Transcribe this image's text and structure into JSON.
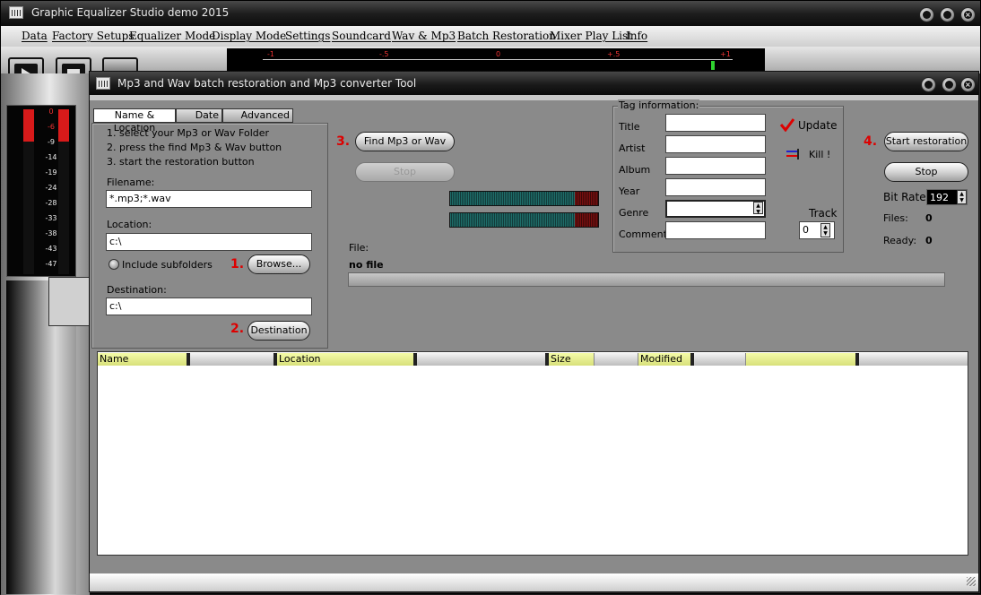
{
  "window": {
    "title": "Graphic Equalizer Studio demo 2015"
  },
  "menu": [
    "Data",
    "Factory Setups",
    "Equalizer Mode",
    "Display Mode",
    "Settings",
    "Soundcard",
    "Wav & Mp3",
    "Batch Restoration",
    "Mixer Play List",
    "Info"
  ],
  "ruler": {
    "labels": [
      "-1",
      "-.5",
      "0",
      "+.5",
      "+1"
    ]
  },
  "meter": {
    "labels": [
      "0",
      "-6",
      "-9",
      "-14",
      "-19",
      "-24",
      "-28",
      "-33",
      "-38",
      "-43",
      "-47"
    ]
  },
  "tool": {
    "title": "Mp3 and Wav batch restoration and Mp3 converter Tool",
    "tabs": [
      "Name & Location",
      "Date",
      "Advanced"
    ],
    "instructions": [
      "1. select your Mp3 or Wav Folder",
      "2. press the find Mp3 & Wav button",
      "3. start the restoration button"
    ],
    "filename_label": "Filename:",
    "filename_value": "*.mp3;*.wav",
    "location_label": "Location:",
    "location_value": "c:\\",
    "include_subfolders": "Include subfolders",
    "browse": "Browse...",
    "destination_label": "Destination:",
    "destination_value": "c:\\",
    "destination_button": "Destination",
    "step1": "1.",
    "step2": "2.",
    "step3": "3.",
    "step4": "4.",
    "find": "Find Mp3 or Wav",
    "stop_disabled": "Stop",
    "file_label": "File:",
    "file_value": "no file",
    "tag": {
      "group": "Tag information:",
      "title": "Title",
      "artist": "Artist",
      "album": "Album",
      "year": "Year",
      "genre": "Genre",
      "comment": "Comment",
      "track": "Track",
      "track_value": "0",
      "update": "Update",
      "kill": "Kill !"
    },
    "start": "Start restoration",
    "stop": "Stop",
    "bitrate_label": "Bit Rate:",
    "bitrate_value": "192",
    "files_label": "Files:",
    "files_value": "0",
    "ready_label": "Ready:",
    "ready_value": "0",
    "table_headers": [
      "Name",
      "",
      "Location",
      "",
      "Size",
      "",
      "Modified",
      "",
      "",
      ""
    ]
  }
}
